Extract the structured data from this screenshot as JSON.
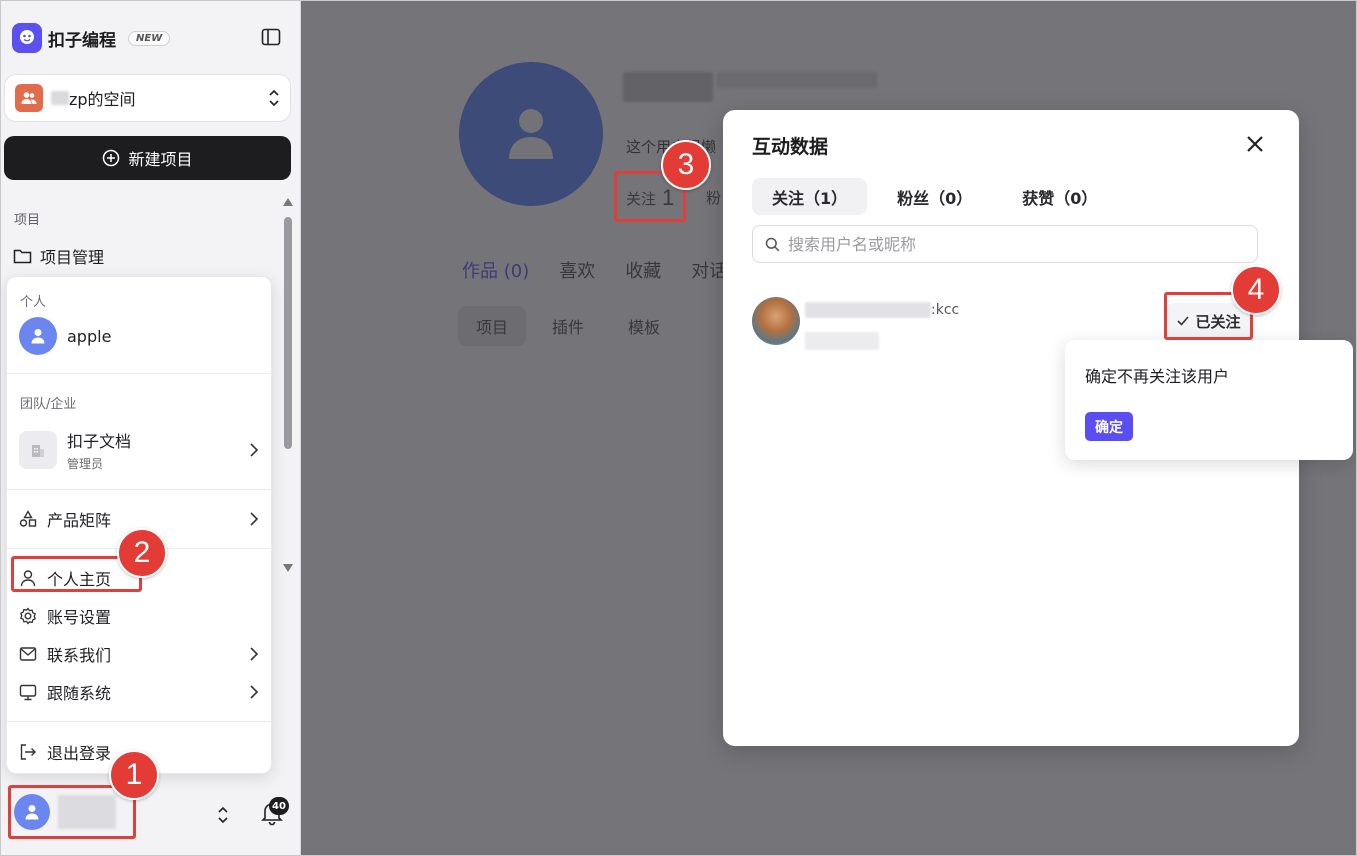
{
  "app": {
    "logo_text": "扣子编程",
    "logo_badge": "NEW"
  },
  "sidebar": {
    "space_name": "zp的空间",
    "new_project": "新建项目",
    "section_label": "项目",
    "project_mgmt": "项目管理",
    "bell_count": "40"
  },
  "menu": {
    "personal_label": "个人",
    "personal_name": "apple",
    "team_label": "团队/企业",
    "team_name": "扣子文档",
    "team_role": "管理员",
    "items": [
      {
        "label": "产品矩阵"
      },
      {
        "label": "个人主页"
      },
      {
        "label": "账号设置"
      },
      {
        "label": "联系我们"
      },
      {
        "label": "跟随系统"
      },
      {
        "label": "退出登录"
      }
    ]
  },
  "profile": {
    "bio": "这个用户很懒",
    "follow_label": "关注",
    "follow_count": "1",
    "fans_label": "粉",
    "tabs": [
      "作品 (0)",
      "喜欢",
      "收藏",
      "对话"
    ],
    "subtabs": [
      "项目",
      "插件",
      "模板"
    ]
  },
  "modal": {
    "title": "互动数据",
    "tabs": [
      "关注（1）",
      "粉丝（0）",
      "获赞（0）"
    ],
    "search_placeholder": "搜索用户名或昵称",
    "user_suffix": ":kcc",
    "followed_label": "已关注"
  },
  "popover": {
    "text": "确定不再关注该用户",
    "confirm": "确定"
  },
  "annotations": [
    "1",
    "2",
    "3",
    "4"
  ],
  "colors": {
    "accent": "#5a4ef3",
    "annotation": "#e33b36",
    "avatar": "#2f4893"
  }
}
